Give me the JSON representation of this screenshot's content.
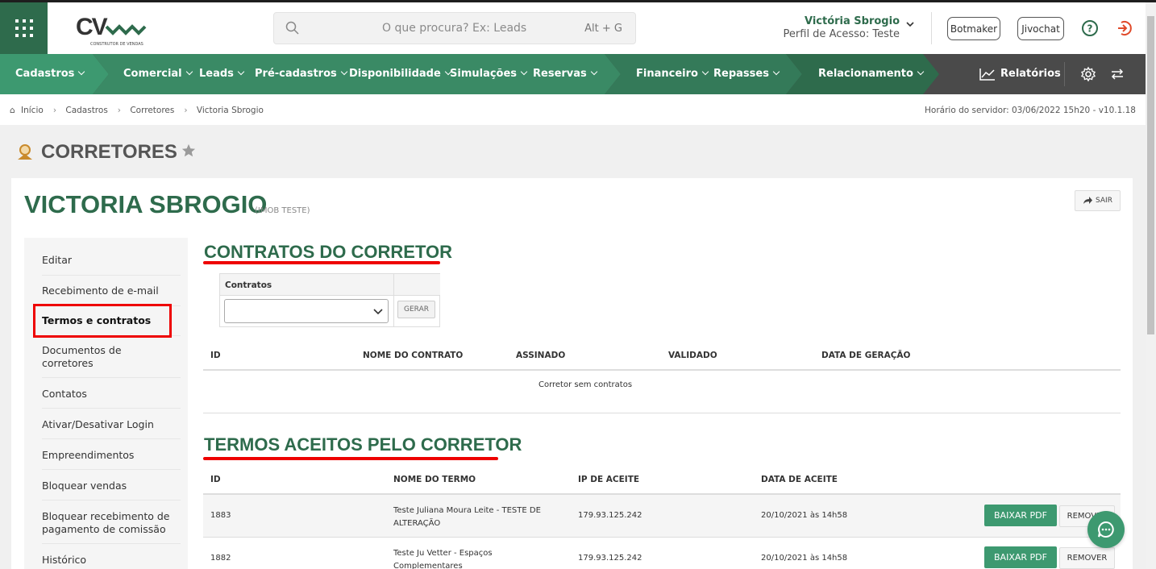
{
  "header": {
    "logo_text": "CV",
    "logo_sub": "CONSTRUTOR DE VENDAS",
    "search_placeholder": "O que procura? Ex: Leads",
    "search_shortcut": "Alt + G",
    "user_name": "Victória Sbrogio",
    "user_profile": "Perfil de Acesso: Teste",
    "botmaker": "Botmaker",
    "jivochat": "Jivochat"
  },
  "nav": {
    "items": [
      "Cadastros",
      "Comercial",
      "Leads",
      "Pré-cadastros",
      "Disponibilidade",
      "Simulações",
      "Reservas",
      "Financeiro",
      "Repasses",
      "Relacionamento"
    ],
    "reports": "Relatórios",
    "colors": {
      "seg1": "#3d9970",
      "seg2": "#3a8a65",
      "seg3": "#347a59",
      "seg4": "#2e6b4c",
      "rest": "#4a4a4a"
    }
  },
  "breadcrumb": {
    "items": [
      "Início",
      "Cadastros",
      "Corretores",
      "Victoria Sbrogio"
    ],
    "server_time": "Horário do servidor: 03/06/2022 15h20 - v10.1.18"
  },
  "page": {
    "title": "CORRETORES",
    "broker_name": "VICTORIA SBROGIO",
    "broker_sub": "(IMOB TESTE)",
    "exit_label": "SAIR"
  },
  "sidemenu": {
    "items": [
      "Editar",
      "Recebimento de e-mail",
      "Termos e contratos",
      "Documentos de corretores",
      "Contatos",
      "Ativar/Desativar Login",
      "Empreendimentos",
      "Bloquear vendas",
      "Bloquear recebimento de pagamento de comissão",
      "Histórico"
    ],
    "active": "Termos e contratos"
  },
  "contracts": {
    "title": "CONTRATOS DO CORRETOR",
    "select_label": "Contratos",
    "select_value": "",
    "generate_label": "GERAR",
    "columns": [
      "ID",
      "NOME DO CONTRATO",
      "ASSINADO",
      "VALIDADO",
      "DATA DE GERAÇÃO"
    ],
    "empty_message": "Corretor sem contratos"
  },
  "terms": {
    "title": "TERMOS ACEITOS PELO CORRETOR",
    "columns": [
      "ID",
      "NOME DO TERMO",
      "IP DE ACEITE",
      "DATA DE ACEITE"
    ],
    "rows": [
      {
        "id": "1883",
        "name_line1": "Teste Juliana Moura Leite - TESTE DE",
        "name_line2": "ALTERAÇÃO",
        "ip": "179.93.125.242",
        "date": "20/10/2021 às 14h58",
        "download": "BAIXAR PDF",
        "remove": "REMOVER"
      },
      {
        "id": "1882",
        "name_line1": "Teste Ju Vetter - Espaços",
        "name_line2": "Complementares",
        "ip": "179.93.125.242",
        "date": "20/10/2021 às 14h58",
        "download": "BAIXAR PDF",
        "remove": "REMOVER"
      }
    ]
  }
}
